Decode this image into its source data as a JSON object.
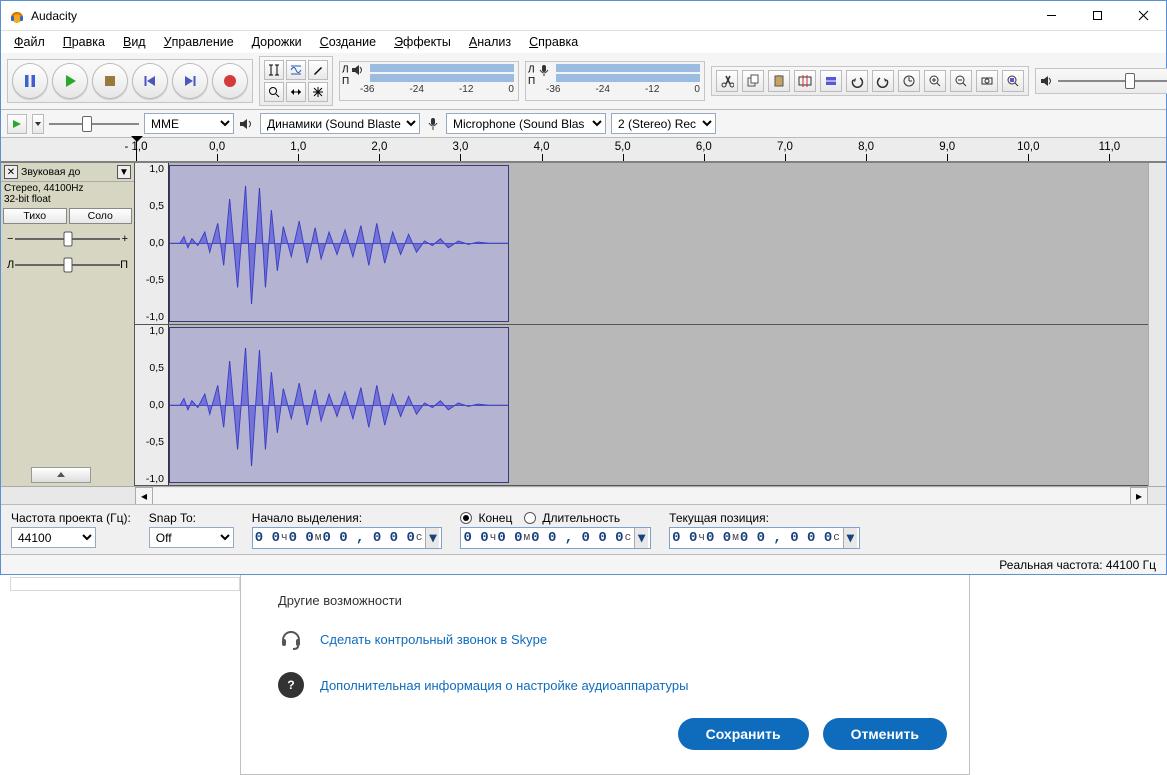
{
  "app_title": "Audacity",
  "menu": [
    "Файл",
    "Правка",
    "Вид",
    "Управление",
    "Дорожки",
    "Создание",
    "Эффекты",
    "Анализ",
    "Справка"
  ],
  "transport_icons": [
    "pause",
    "play",
    "stop",
    "skip-start",
    "skip-end",
    "record"
  ],
  "tool_icons_top": [
    "selection",
    "envelope",
    "draw"
  ],
  "tool_icons_bottom": [
    "zoom",
    "timeshift",
    "multi"
  ],
  "meter_labels": {
    "left": "Л",
    "right": "П"
  },
  "playback_ticks": [
    "-36",
    "-24",
    "-12",
    "0"
  ],
  "record_ticks": [
    "-36",
    "-24",
    "-12",
    "0"
  ],
  "edit_icons": [
    "cut",
    "copy",
    "paste",
    "trim",
    "silence",
    "undo",
    "redo",
    "sync",
    "zoom-in",
    "zoom-out",
    "zoom-fit",
    "zoom-sel"
  ],
  "device_row": {
    "host_api": "MME",
    "host_options": [
      "MME"
    ],
    "output_device": "Динамики (Sound Blaste",
    "input_device": "Microphone (Sound Blas",
    "channels": "2 (Stereo) Rec"
  },
  "timeline": {
    "start": -1.0,
    "end": 11.5,
    "major_ticks": [
      "- 1,0",
      "0,0",
      "1,0",
      "2,0",
      "3,0",
      "4,0",
      "5,0",
      "6,0",
      "7,0",
      "8,0",
      "9,0",
      "10,0",
      "11,0"
    ]
  },
  "track": {
    "name": "Звуковая до",
    "format": "Стерео, 44100Hz",
    "bits": "32-bit float",
    "mute_label": "Тихо",
    "solo_label": "Соло",
    "pan_left": "Л",
    "pan_right": "П",
    "yscale": [
      "1,0",
      "0,5",
      "0,0",
      "-0,5",
      "-1,0"
    ]
  },
  "selection_bar": {
    "project_rate_label": "Частота проекта (Гц):",
    "project_rate": "44100",
    "snap_label": "Snap To:",
    "snap_value": "Off",
    "start_label": "Начало выделения:",
    "end_label": "Конец",
    "length_label": "Длительность",
    "position_label": "Текущая позиция:",
    "time_h": "0 0",
    "time_h_unit": "ч",
    "time_m": "0 0",
    "time_m_unit": "м",
    "time_s": "0 0 , 0 0 0",
    "time_s_unit": "с"
  },
  "status": {
    "actual_rate_label": "Реальная частота:",
    "actual_rate": "44100 Гц"
  },
  "dialog": {
    "heading": "Другие возможности",
    "link1": "Сделать контрольный звонок в Skype",
    "link2": "Дополнительная информация о настройке аудиоаппаратуры",
    "save": "Сохранить",
    "cancel": "Отменить"
  }
}
